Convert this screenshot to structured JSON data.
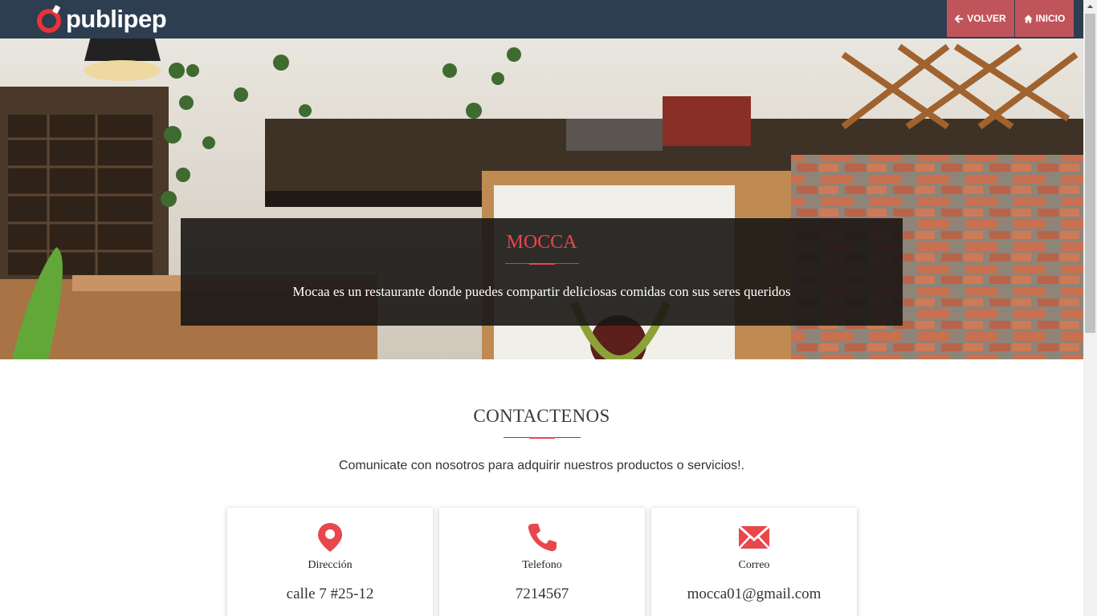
{
  "nav": {
    "brand": "publipep",
    "back_label": "VOLVER",
    "home_label": "INICIO"
  },
  "hero": {
    "title": "MOCCA",
    "description": "Mocaa es un restaurante donde puedes compartir deliciosas comidas con sus seres queridos"
  },
  "contact": {
    "title": "CONTACTENOS",
    "subtitle": "Comunicate con nosotros para adquirir nuestros productos o servicios!.",
    "cards": [
      {
        "icon": "location-pin-icon",
        "label": "Dirección",
        "value": "calle 7 #25-12"
      },
      {
        "icon": "phone-icon",
        "label": "Telefono",
        "value": "7214567"
      },
      {
        "icon": "envelope-icon",
        "label": "Correo",
        "value": "mocca01@gmail.com"
      }
    ]
  },
  "colors": {
    "navbar": "#2c3e50",
    "nav_button": "#c0545b",
    "accent": "#e8474b"
  }
}
